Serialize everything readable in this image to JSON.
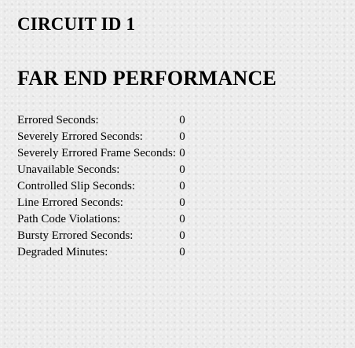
{
  "circuit_title": "CIRCUIT ID 1",
  "section_title": "FAR END PERFORMANCE",
  "stats": [
    {
      "label": "Errored Seconds:",
      "value": "0"
    },
    {
      "label": "Severely Errored Seconds:",
      "value": "0"
    },
    {
      "label": "Severely Errored Frame Seconds:",
      "value": "0"
    },
    {
      "label": "Unavailable Seconds:",
      "value": "0"
    },
    {
      "label": "Controlled Slip Seconds:",
      "value": "0"
    },
    {
      "label": "Line Errored Seconds:",
      "value": "0"
    },
    {
      "label": "Path Code Violations:",
      "value": "0"
    },
    {
      "label": "Bursty Errored Seconds:",
      "value": "0"
    },
    {
      "label": "Degraded Minutes:",
      "value": "0"
    }
  ]
}
